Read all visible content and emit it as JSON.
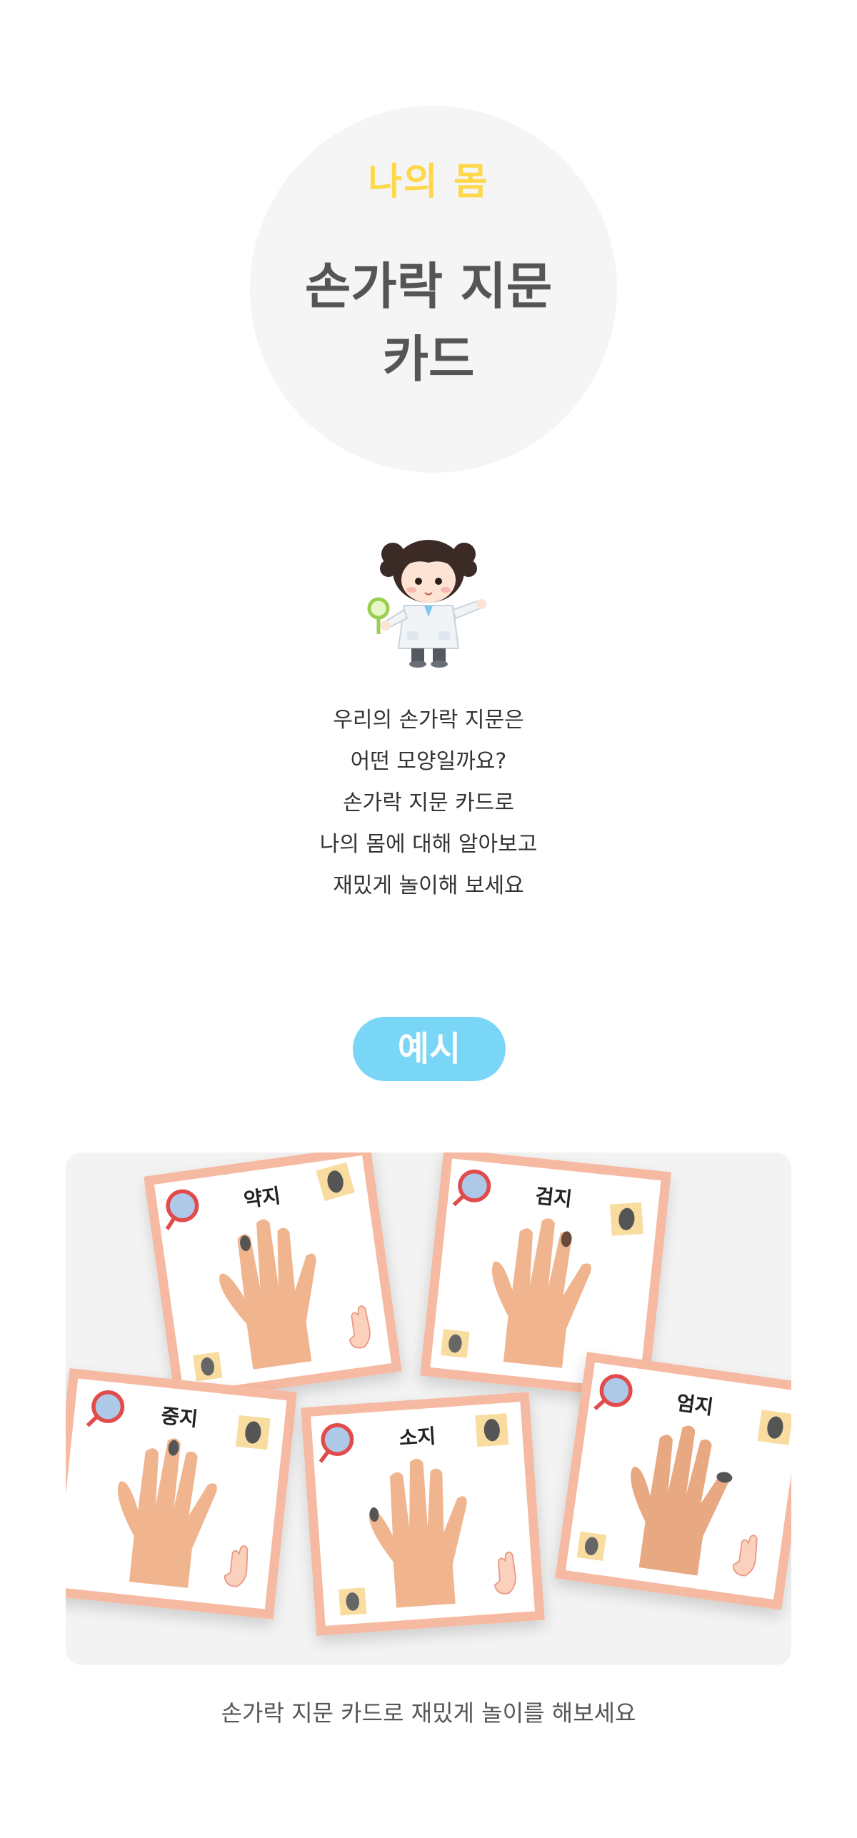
{
  "header": {
    "kicker": "나의 몸",
    "title_line1": "손가락 지문",
    "title_line2": "카드"
  },
  "intro": {
    "lines": [
      "우리의 손가락 지문은",
      "어떤 모양일까요?",
      "손가락 지문 카드로",
      "나의 몸에 대해 알아보고",
      "재밌게 놀이해 보세요"
    ]
  },
  "example": {
    "badge": "예시",
    "cards": [
      {
        "label": "약지"
      },
      {
        "label": "검지"
      },
      {
        "label": "중지"
      },
      {
        "label": "소지"
      },
      {
        "label": "엄지"
      }
    ],
    "caption": "손가락 지문 카드로 재밌게 놀이를 해보세요"
  },
  "colors": {
    "kicker": "#ffd84a",
    "title": "#555555",
    "badge_bg": "#7ad6f7",
    "card_border": "#f6b9a2"
  }
}
